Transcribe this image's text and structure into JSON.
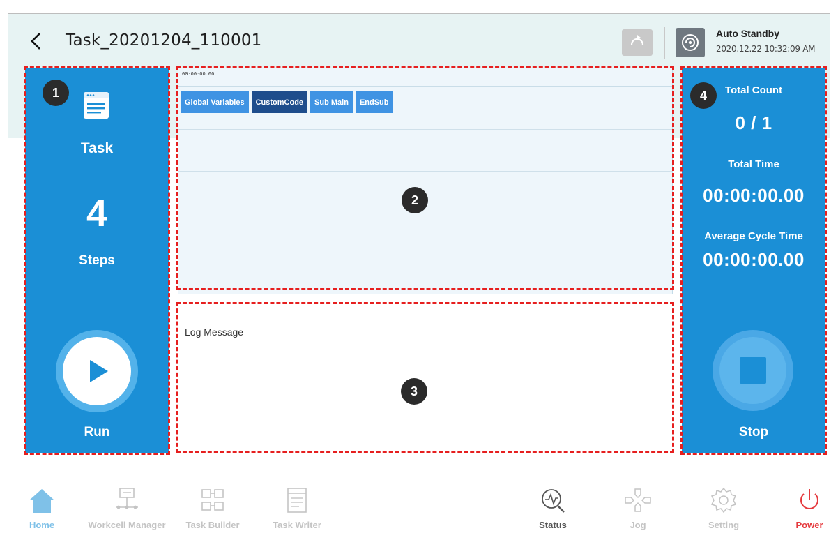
{
  "header": {
    "title": "Task_20201204_110001",
    "mode_title": "Auto Standby",
    "mode_time": "2020.12.22 10:32:09 AM"
  },
  "callouts": [
    "1",
    "2",
    "3",
    "4"
  ],
  "left_panel": {
    "task_label": "Task",
    "steps_count": "4",
    "steps_label": "Steps",
    "run_label": "Run"
  },
  "timeline": {
    "time": "00:00:00.00",
    "blocks": [
      "Global Variables",
      "CustomCode",
      "Sub Main",
      "EndSub"
    ],
    "selected_block": "CustomCode"
  },
  "log": {
    "title": "Log Message"
  },
  "right_panel": {
    "total_count_label": "Total Count",
    "total_count_value": "0 / 1",
    "total_time_label": "Total Time",
    "total_time_value": "00:00:00.00",
    "avg_cycle_label": "Average Cycle Time",
    "avg_cycle_value": "00:00:00.00",
    "stop_label": "Stop"
  },
  "nav": {
    "items": [
      {
        "label": "Home",
        "icon": "home-icon"
      },
      {
        "label": "Workcell Manager",
        "icon": "workcell-icon"
      },
      {
        "label": "Task Builder",
        "icon": "task-builder-icon"
      },
      {
        "label": "Task Writer",
        "icon": "task-writer-icon"
      },
      {
        "label": "Status",
        "icon": "status-icon"
      },
      {
        "label": "Jog",
        "icon": "jog-icon"
      },
      {
        "label": "Setting",
        "icon": "gear-icon"
      },
      {
        "label": "Power",
        "icon": "power-icon"
      }
    ]
  },
  "colors": {
    "panel_blue": "#1b8fd6",
    "callout_red": "#e61f1f",
    "header_bg": "#e7f3f3",
    "block_blue": "#3f93e3",
    "block_selected": "#1e4d8c",
    "power_red": "#e5393d"
  }
}
